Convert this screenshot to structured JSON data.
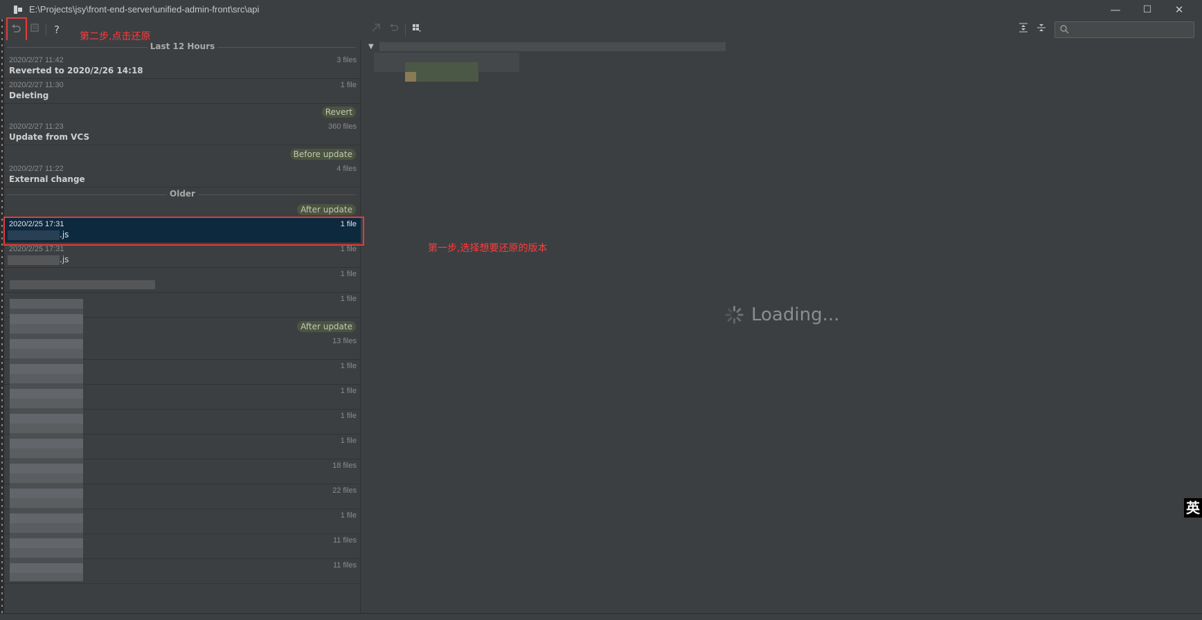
{
  "window": {
    "title": "E:\\Projects\\jsy\\front-end-server\\unified-admin-front\\src\\api",
    "minimize": "—",
    "maximize": "☐",
    "close": "✕"
  },
  "toolbar": {
    "revert_icon": "undo-icon",
    "help_label": "?",
    "annotation_step2": "第二步,点击还原"
  },
  "groups": {
    "recent": "Last 12 Hours",
    "older": "Older"
  },
  "entries": [
    {
      "date": "2020/2/27 11:42",
      "count": "3 files",
      "message": "Reverted to 2020/2/26 14:18"
    },
    {
      "date": "2020/2/27 11:30",
      "count": "1 file",
      "message": "Deleting"
    },
    {
      "date": "2020/2/27 11:23",
      "count": "360 files",
      "message": "Update from VCS",
      "label_before": "Revert"
    },
    {
      "date": "2020/2/27 11:22",
      "count": "4 files",
      "message": "External change",
      "label_before": "Before update"
    },
    {
      "date": "2020/2/25 17:31",
      "count": "1 file",
      "message": ".js",
      "label_before": "After update",
      "selected": true
    },
    {
      "date": "2020/2/25 17:31",
      "count": "1 file",
      "message": ".js"
    },
    {
      "count": "1 file"
    },
    {
      "count": "1 file"
    },
    {
      "count": "13 files",
      "label_before": "After update"
    },
    {
      "count": "1 file"
    },
    {
      "count": "1 file"
    },
    {
      "count": "1 file"
    },
    {
      "count": "1 file"
    },
    {
      "count": "18 files"
    },
    {
      "count": "22 files"
    },
    {
      "count": "1 file"
    },
    {
      "count": "11 files"
    },
    {
      "count": "11 files"
    }
  ],
  "annotation_step1": "第一步,选择想要还原的版本",
  "loading_text": "Loading...",
  "ime_indicator": "英",
  "colors": {
    "background": "#3c3f41",
    "selection": "#0d293e",
    "annotation_red": "#ff3b3b",
    "label_bg": "#4b5440"
  }
}
